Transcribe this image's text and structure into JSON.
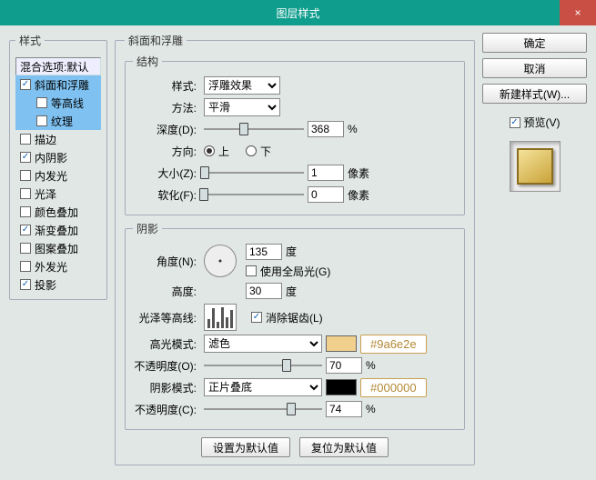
{
  "window": {
    "title": "图层样式",
    "close_icon": "×"
  },
  "side_buttons": {
    "ok": "确定",
    "cancel": "取消",
    "new_style": "新建样式(W)...",
    "preview": "预览(V)"
  },
  "styles_panel": {
    "legend": "样式",
    "header": "混合选项:默认",
    "items": [
      {
        "key": "bevel",
        "label": "斜面和浮雕",
        "checked": true,
        "selected": true
      },
      {
        "key": "contour",
        "label": "等高线",
        "checked": false,
        "sub": true,
        "selected": true
      },
      {
        "key": "texture",
        "label": "纹理",
        "checked": false,
        "sub": true,
        "selected": true
      },
      {
        "key": "stroke",
        "label": "描边",
        "checked": false
      },
      {
        "key": "innershadow",
        "label": "内阴影",
        "checked": true
      },
      {
        "key": "innerglow",
        "label": "内发光",
        "checked": false
      },
      {
        "key": "satin",
        "label": "光泽",
        "checked": false
      },
      {
        "key": "coloroverlay",
        "label": "颜色叠加",
        "checked": false
      },
      {
        "key": "gradoverlay",
        "label": "渐变叠加",
        "checked": true
      },
      {
        "key": "patternoverlay",
        "label": "图案叠加",
        "checked": false
      },
      {
        "key": "outerglow",
        "label": "外发光",
        "checked": false
      },
      {
        "key": "dropshadow",
        "label": "投影",
        "checked": true
      }
    ]
  },
  "bevel": {
    "legend": "斜面和浮雕",
    "structure_legend": "结构",
    "style_label": "样式:",
    "style_value": "浮雕效果",
    "method_label": "方法:",
    "method_value": "平滑",
    "depth_label": "深度(D):",
    "depth_value": "368",
    "pct": "%",
    "dir_label": "方向:",
    "dir_up": "上",
    "dir_down": "下",
    "size_label": "大小(Z):",
    "size_value": "1",
    "px": "像素",
    "soften_label": "软化(F):",
    "soften_value": "0"
  },
  "shade": {
    "legend": "阴影",
    "angle_label": "角度(N):",
    "angle_value": "135",
    "deg": "度",
    "global_label": "使用全局光(G)",
    "alt_label": "高度:",
    "alt_value": "30",
    "gloss_label": "光泽等高线:",
    "aa_label": "消除锯齿(L)",
    "hl_mode_label": "高光模式:",
    "hl_mode_value": "滤色",
    "hl_hex": "#9a6e2e",
    "hl_swatch": "#f1cf8d",
    "hl_op_label": "不透明度(O):",
    "hl_op_value": "70",
    "sh_mode_label": "阴影模式:",
    "sh_mode_value": "正片叠底",
    "sh_hex": "#000000",
    "sh_swatch": "#000000",
    "sh_op_label": "不透明度(C):",
    "sh_op_value": "74"
  },
  "footer": {
    "make_default": "设置为默认值",
    "reset_default": "复位为默认值"
  }
}
